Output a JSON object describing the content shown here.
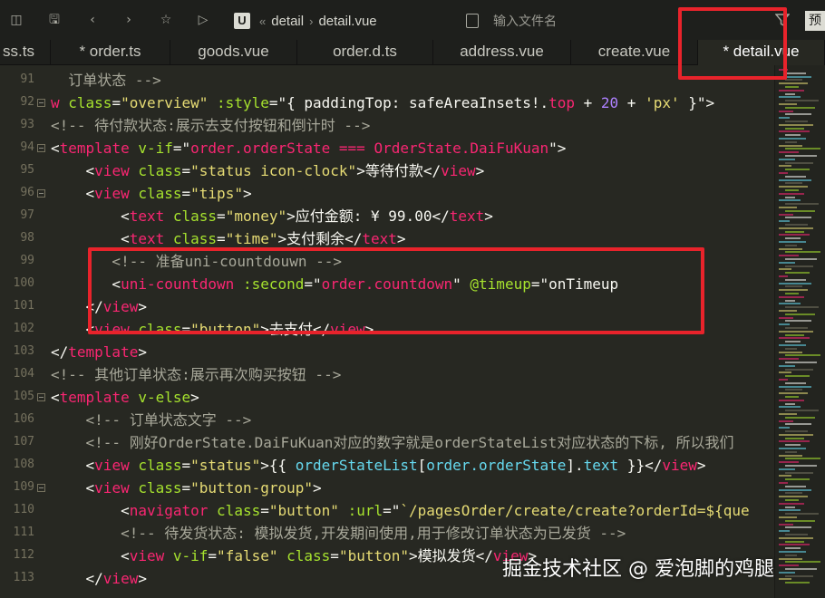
{
  "toolbar": {
    "breadcrumb": [
      "detail",
      "detail.vue"
    ],
    "app_icon_letter": "U",
    "search_placeholder": "输入文件名",
    "right_button_label": "预"
  },
  "tabs": [
    {
      "label": "ss.ts",
      "active": false
    },
    {
      "label": "* order.ts",
      "active": false
    },
    {
      "label": "goods.vue",
      "active": false
    },
    {
      "label": "order.d.ts",
      "active": false
    },
    {
      "label": "address.vue",
      "active": false
    },
    {
      "label": "create.vue",
      "active": false
    },
    {
      "label": "* detail.vue",
      "active": true
    }
  ],
  "editor": {
    "line_numbers": [
      "91",
      "92",
      "93",
      "94",
      "95",
      "96",
      "97",
      "98",
      "99",
      "100",
      "101",
      "102",
      "103",
      "104",
      "105",
      "106",
      "107",
      "108",
      "109",
      "110",
      "111",
      "112",
      "113"
    ],
    "lines": [
      [
        {
          "t": "cm",
          "v": "  订单状态 -->"
        }
      ],
      [
        {
          "t": "tg",
          "v": "w "
        },
        {
          "t": "at",
          "v": "class"
        },
        {
          "t": "pn",
          "v": "="
        },
        {
          "t": "st",
          "v": "\"overview\""
        },
        {
          "t": "pn",
          "v": " "
        },
        {
          "t": "at",
          "v": ":style"
        },
        {
          "t": "pn",
          "v": "=\"{ paddingTop: safeAreaInsets!."
        },
        {
          "t": "tg",
          "v": "top"
        },
        {
          "t": "pn",
          "v": " + "
        },
        {
          "t": "nm",
          "v": "20"
        },
        {
          "t": "pn",
          "v": " + "
        },
        {
          "t": "st",
          "v": "'px'"
        },
        {
          "t": "pn",
          "v": " }\">"
        }
      ],
      [
        {
          "t": "cm",
          "v": "<!-- 待付款状态:展示去支付按钮和倒计时 -->"
        }
      ],
      [
        {
          "t": "pn",
          "v": "<"
        },
        {
          "t": "tg",
          "v": "template"
        },
        {
          "t": "pn",
          "v": " "
        },
        {
          "t": "at",
          "v": "v-if"
        },
        {
          "t": "pn",
          "v": "=\""
        },
        {
          "t": "tg",
          "v": "order.orderState"
        },
        {
          "t": "pn",
          "v": " "
        },
        {
          "t": "tg",
          "v": "==="
        },
        {
          "t": "pn",
          "v": " "
        },
        {
          "t": "tg",
          "v": "OrderState.DaiFuKuan"
        },
        {
          "t": "pn",
          "v": "\">"
        }
      ],
      [
        {
          "t": "pn",
          "v": "    <"
        },
        {
          "t": "tg",
          "v": "view"
        },
        {
          "t": "pn",
          "v": " "
        },
        {
          "t": "at",
          "v": "class"
        },
        {
          "t": "pn",
          "v": "="
        },
        {
          "t": "st",
          "v": "\"status icon-clock\""
        },
        {
          "t": "pn",
          "v": ">等待付款</"
        },
        {
          "t": "tg",
          "v": "view"
        },
        {
          "t": "pn",
          "v": ">"
        }
      ],
      [
        {
          "t": "pn",
          "v": "    <"
        },
        {
          "t": "tg",
          "v": "view"
        },
        {
          "t": "pn",
          "v": " "
        },
        {
          "t": "at",
          "v": "class"
        },
        {
          "t": "pn",
          "v": "="
        },
        {
          "t": "st",
          "v": "\"tips\""
        },
        {
          "t": "pn",
          "v": ">"
        }
      ],
      [
        {
          "t": "pn",
          "v": "        <"
        },
        {
          "t": "tg",
          "v": "text"
        },
        {
          "t": "pn",
          "v": " "
        },
        {
          "t": "at",
          "v": "class"
        },
        {
          "t": "pn",
          "v": "="
        },
        {
          "t": "st",
          "v": "\"money\""
        },
        {
          "t": "pn",
          "v": ">应付金额: ¥ 99.00</"
        },
        {
          "t": "tg",
          "v": "text"
        },
        {
          "t": "pn",
          "v": ">"
        }
      ],
      [
        {
          "t": "pn",
          "v": "        <"
        },
        {
          "t": "tg",
          "v": "text"
        },
        {
          "t": "pn",
          "v": " "
        },
        {
          "t": "at",
          "v": "class"
        },
        {
          "t": "pn",
          "v": "="
        },
        {
          "t": "st",
          "v": "\"time\""
        },
        {
          "t": "pn",
          "v": ">支付剩余</"
        },
        {
          "t": "tg",
          "v": "text"
        },
        {
          "t": "pn",
          "v": ">"
        }
      ],
      [
        {
          "t": "cm",
          "v": "       <!-- 准备uni-countdouwn -->"
        }
      ],
      [
        {
          "t": "pn",
          "v": "       <"
        },
        {
          "t": "tg",
          "v": "uni-countdown"
        },
        {
          "t": "pn",
          "v": " "
        },
        {
          "t": "at",
          "v": ":second"
        },
        {
          "t": "pn",
          "v": "=\""
        },
        {
          "t": "tg",
          "v": "order.countdown"
        },
        {
          "t": "pn",
          "v": "\" "
        },
        {
          "t": "at",
          "v": "@timeup"
        },
        {
          "t": "pn",
          "v": "=\"onTimeup"
        }
      ],
      [
        {
          "t": "pn",
          "v": "    </"
        },
        {
          "t": "tg",
          "v": "view"
        },
        {
          "t": "pn",
          "v": ">"
        }
      ],
      [
        {
          "t": "pn",
          "v": "    <"
        },
        {
          "t": "tg",
          "v": "view"
        },
        {
          "t": "pn",
          "v": " "
        },
        {
          "t": "at",
          "v": "class"
        },
        {
          "t": "pn",
          "v": "="
        },
        {
          "t": "st",
          "v": "\"button\""
        },
        {
          "t": "pn",
          "v": ">去支付</"
        },
        {
          "t": "tg",
          "v": "view"
        },
        {
          "t": "pn",
          "v": ">"
        }
      ],
      [
        {
          "t": "pn",
          "v": "</"
        },
        {
          "t": "tg",
          "v": "template"
        },
        {
          "t": "pn",
          "v": ">"
        }
      ],
      [
        {
          "t": "cm",
          "v": "<!-- 其他订单状态:展示再次购买按钮 -->"
        }
      ],
      [
        {
          "t": "pn",
          "v": "<"
        },
        {
          "t": "tg",
          "v": "template"
        },
        {
          "t": "pn",
          "v": " "
        },
        {
          "t": "at",
          "v": "v-else"
        },
        {
          "t": "pn",
          "v": ">"
        }
      ],
      [
        {
          "t": "cm",
          "v": "    <!-- 订单状态文字 -->"
        }
      ],
      [
        {
          "t": "cm",
          "v": "    <!-- 刚好OrderState.DaiFuKuan对应的数字就是orderStateList对应状态的下标, 所以我们"
        }
      ],
      [
        {
          "t": "pn",
          "v": "    <"
        },
        {
          "t": "tg",
          "v": "view"
        },
        {
          "t": "pn",
          "v": " "
        },
        {
          "t": "at",
          "v": "class"
        },
        {
          "t": "pn",
          "v": "="
        },
        {
          "t": "st",
          "v": "\"status\""
        },
        {
          "t": "pn",
          "v": ">{{ "
        },
        {
          "t": "ob",
          "v": "orderStateList"
        },
        {
          "t": "pn",
          "v": "["
        },
        {
          "t": "ob",
          "v": "order.orderState"
        },
        {
          "t": "pn",
          "v": "]."
        },
        {
          "t": "ob",
          "v": "text"
        },
        {
          "t": "pn",
          "v": " }}</"
        },
        {
          "t": "tg",
          "v": "view"
        },
        {
          "t": "pn",
          "v": ">"
        }
      ],
      [
        {
          "t": "pn",
          "v": "    <"
        },
        {
          "t": "tg",
          "v": "view"
        },
        {
          "t": "pn",
          "v": " "
        },
        {
          "t": "at",
          "v": "class"
        },
        {
          "t": "pn",
          "v": "="
        },
        {
          "t": "st",
          "v": "\"button-group\""
        },
        {
          "t": "pn",
          "v": ">"
        }
      ],
      [
        {
          "t": "pn",
          "v": "        <"
        },
        {
          "t": "tg",
          "v": "navigator"
        },
        {
          "t": "pn",
          "v": " "
        },
        {
          "t": "at",
          "v": "class"
        },
        {
          "t": "pn",
          "v": "="
        },
        {
          "t": "st",
          "v": "\"button\""
        },
        {
          "t": "pn",
          "v": " "
        },
        {
          "t": "at",
          "v": ":url"
        },
        {
          "t": "pn",
          "v": "=\""
        },
        {
          "t": "st",
          "v": "`/pagesOrder/create/create?orderId=${que"
        }
      ],
      [
        {
          "t": "cm",
          "v": "        <!-- 待发货状态: 模拟发货,开发期间使用,用于修改订单状态为已发货 -->"
        }
      ],
      [
        {
          "t": "pn",
          "v": "        <"
        },
        {
          "t": "tg",
          "v": "view"
        },
        {
          "t": "pn",
          "v": " "
        },
        {
          "t": "at",
          "v": "v-if"
        },
        {
          "t": "pn",
          "v": "="
        },
        {
          "t": "st",
          "v": "\"false\""
        },
        {
          "t": "pn",
          "v": " "
        },
        {
          "t": "at",
          "v": "class"
        },
        {
          "t": "pn",
          "v": "="
        },
        {
          "t": "st",
          "v": "\"button\""
        },
        {
          "t": "pn",
          "v": ">模拟发货</"
        },
        {
          "t": "tg",
          "v": "view"
        },
        {
          "t": "pn",
          "v": ">"
        }
      ],
      [
        {
          "t": "pn",
          "v": "    </"
        },
        {
          "t": "tg",
          "v": "view"
        },
        {
          "t": "pn",
          "v": ">"
        }
      ]
    ]
  },
  "watermark": "掘金技术社区 @ 爱泡脚的鸡腿",
  "colors": {
    "highlight_box": "#e8232b",
    "editor_bg": "#272822"
  }
}
